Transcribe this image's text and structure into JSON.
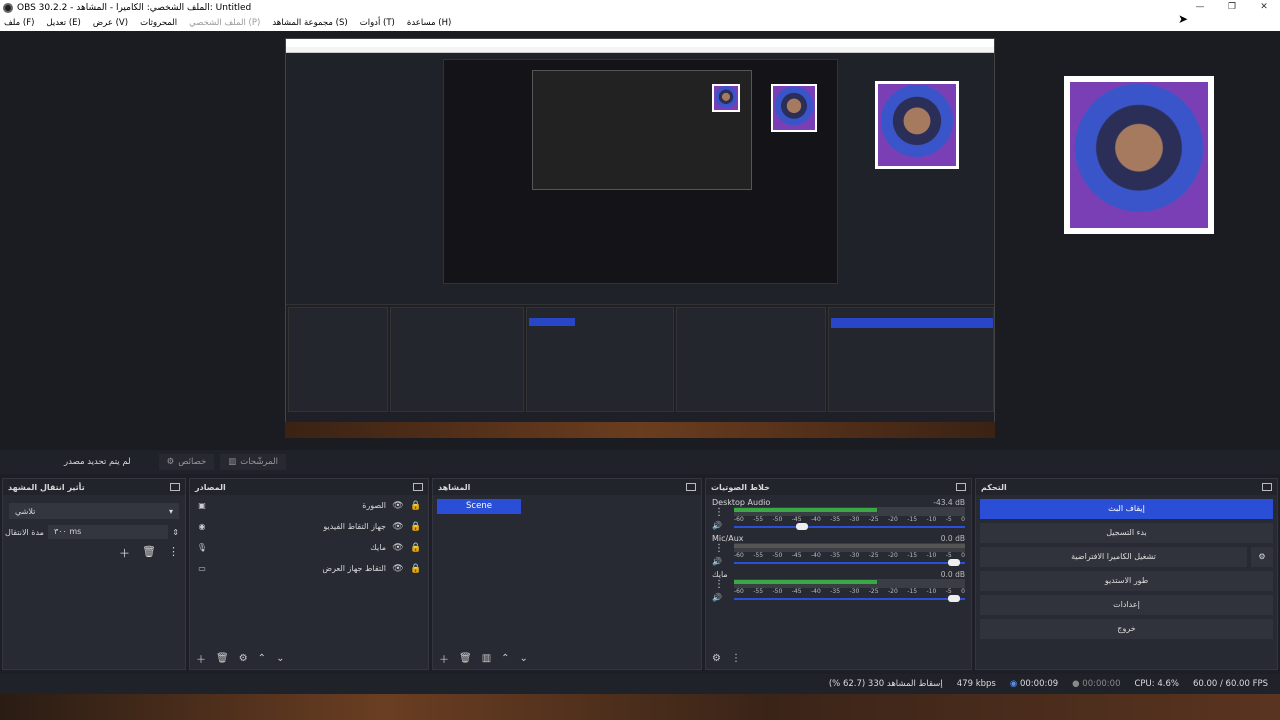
{
  "window": {
    "title": "OBS 30.2.2 - الملف الشخصي: الكاميرا - المشاهد: Untitled",
    "controls": [
      "—",
      "❐",
      "✕"
    ]
  },
  "menu": {
    "items": [
      "ملف (F)",
      "تعديل (E)",
      "عرض (V)",
      "المحروثات",
      "الملف الشخصي (P)",
      "مجموعة المشاهد (S)",
      "أدوات (T)",
      "مساعدة (H)"
    ]
  },
  "topbar": {
    "no_source": "لم يتم تحديد مصدر",
    "properties": "خصائص",
    "filters": "المرشّحات"
  },
  "transitions": {
    "title": "تأثير انتقال المشهد",
    "selected": "تلاشي",
    "duration_label": "مدة الانتقال",
    "duration_value": "٣٠٠ ms"
  },
  "sources": {
    "title": "المصادر",
    "items": [
      {
        "name": "الصورة",
        "icon": "image-icon"
      },
      {
        "name": "جهاز التقاط الفيديو",
        "icon": "camera-icon"
      },
      {
        "name": "مايك",
        "icon": "mic-icon"
      },
      {
        "name": "التقاط جهاز العرض",
        "icon": "monitor-icon"
      }
    ]
  },
  "scenes": {
    "title": "المشاهد",
    "items": [
      "Scene"
    ]
  },
  "mixer": {
    "title": "خلاط الصوتيات",
    "scale": [
      "-60",
      "-55",
      "-50",
      "-45",
      "-40",
      "-35",
      "-30",
      "-25",
      "-20",
      "-15",
      "-10",
      "-5",
      "0"
    ],
    "channels": [
      {
        "name": "Desktop Audio",
        "db": "-43.4 dB",
        "level": 0.62,
        "volume": 0.32
      },
      {
        "name": "Mic/Aux",
        "db": "0.0 dB",
        "level": 0.0,
        "volume": 0.98
      },
      {
        "name": "مايك",
        "db": "0.0 dB",
        "level": 0.62,
        "volume": 0.98
      }
    ]
  },
  "controls": {
    "title": "التحكم",
    "buttons": [
      "إيقاف البث",
      "بدء التسجيل",
      "تشغيل الكاميرا الافتراضية",
      "طور الاستديو",
      "إعدادات",
      "خروج"
    ]
  },
  "status": {
    "dropped": "إسقاط المشاهد 330 (62.7 %)",
    "bitrate": "479 kbps",
    "stream_time": "00:00:09",
    "rec_time": "00:00:00",
    "cpu": "CPU: 4.6%",
    "fps": "60.00 / 60.00 FPS"
  },
  "colors": {
    "accent": "#2a4fd6",
    "meter_green": "#3aa845",
    "meter_yellow": "#c8b13a",
    "meter_red": "#c2302f"
  }
}
